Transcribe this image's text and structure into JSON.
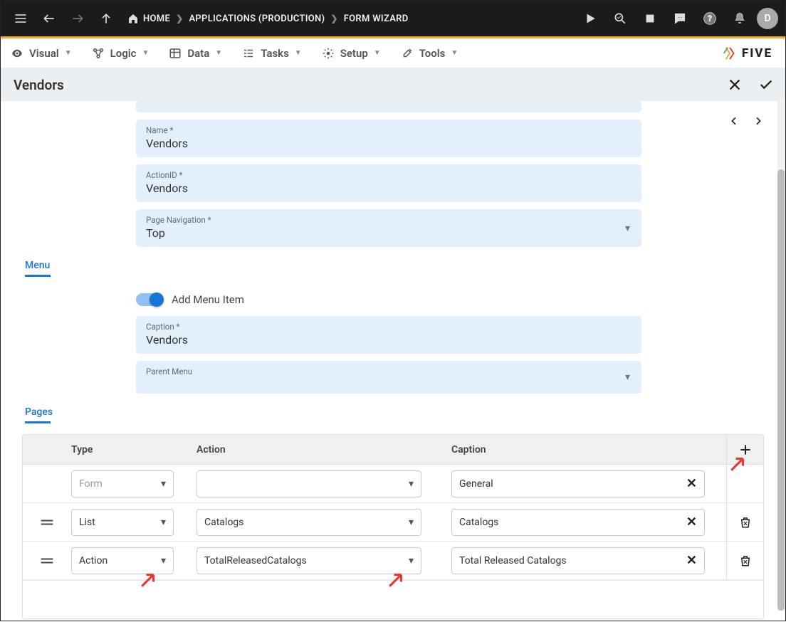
{
  "topbar": {
    "home": "HOME",
    "crumb1": "APPLICATIONS (PRODUCTION)",
    "crumb2": "FORM WIZARD",
    "avatar": "D"
  },
  "toolbar": {
    "visual": "Visual",
    "logic": "Logic",
    "data": "Data",
    "tasks": "Tasks",
    "setup": "Setup",
    "tools": "Tools",
    "brand": "FIVE"
  },
  "page": {
    "title": "Vendors"
  },
  "fields": {
    "name_label": "Name *",
    "name_value": "Vendors",
    "actionid_label": "ActionID *",
    "actionid_value": "Vendors",
    "pagenav_label": "Page Navigation *",
    "pagenav_value": "Top",
    "menu_heading": "Menu",
    "add_menu_item": "Add Menu Item",
    "caption_label": "Caption *",
    "caption_value": "Vendors",
    "parent_menu_label": "Parent Menu",
    "parent_menu_value": "",
    "pages_heading": "Pages"
  },
  "pages_table": {
    "head_type": "Type",
    "head_action": "Action",
    "head_caption": "Caption",
    "rows": [
      {
        "type": "Form",
        "type_placeholder": true,
        "action": "",
        "caption": "General",
        "draggable": false,
        "deletable": false
      },
      {
        "type": "List",
        "type_placeholder": false,
        "action": "Catalogs",
        "caption": "Catalogs",
        "draggable": true,
        "deletable": true
      },
      {
        "type": "Action",
        "type_placeholder": false,
        "action": "TotalReleasedCatalogs",
        "caption": "Total Released Catalogs",
        "draggable": true,
        "deletable": true
      }
    ]
  }
}
